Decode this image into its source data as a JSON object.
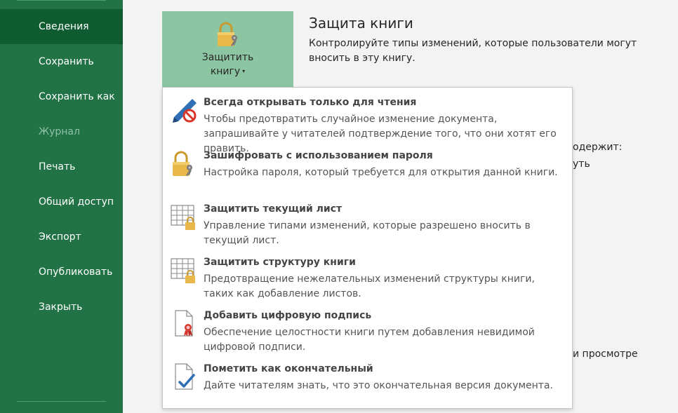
{
  "sidebar": {
    "items": [
      {
        "label": "Сведения",
        "state": "active"
      },
      {
        "label": "Сохранить",
        "state": "normal"
      },
      {
        "label": "Сохранить как",
        "state": "normal"
      },
      {
        "label": "Журнал",
        "state": "disabled"
      },
      {
        "label": "Печать",
        "state": "normal"
      },
      {
        "label": "Общий доступ",
        "state": "normal"
      },
      {
        "label": "Экспорт",
        "state": "normal"
      },
      {
        "label": "Опубликовать",
        "state": "normal"
      },
      {
        "label": "Закрыть",
        "state": "normal"
      }
    ]
  },
  "protect_button": {
    "line1": "Защитить",
    "line2": "книгу",
    "caret": "▾",
    "icon": "lock-key-icon"
  },
  "section": {
    "title": "Защита книги",
    "desc": "Контролируйте типы изменений, которые пользователи могут вносить в эту книгу."
  },
  "background_partial": {
    "text1": "одержит:",
    "text2": "уть",
    "text3": "и просмотре"
  },
  "menu": {
    "items": [
      {
        "title": "Всегда открывать только для чтения",
        "desc": "Чтобы предотвратить случайное изменение документа, запрашивайте у читателей подтверждение того, что они хотят его править.",
        "icon": "pencil-no-edit-icon"
      },
      {
        "title": "Зашифровать с использованием пароля",
        "desc": "Настройка пароля, который требуется для открытия данной книги.",
        "icon": "lock-key-icon"
      },
      {
        "title": "Защитить текущий лист",
        "desc": "Управление типами изменений, которые разрешено вносить в текущий лист.",
        "icon": "sheet-lock-icon"
      },
      {
        "title": "Защитить структуру книги",
        "desc": "Предотвращение нежелательных изменений структуры книги, таких как добавление листов.",
        "icon": "workbook-lock-icon"
      },
      {
        "title": "Добавить цифровую подпись",
        "desc": "Обеспечение целостности книги путем добавления невидимой цифровой подписи.",
        "icon": "document-ribbon-icon"
      },
      {
        "title": "Пометить как окончательный",
        "desc": "Дайте читателям знать, что это окончательная версия документа.",
        "icon": "document-check-icon"
      }
    ]
  },
  "colors": {
    "sidebar_bg": "#217346",
    "sidebar_active": "#0e5c2f",
    "button_bg": "#8bc5a2",
    "lock_gold": "#e8b84a",
    "no_red": "#d9352b",
    "pencil_blue": "#2e6fb5"
  }
}
